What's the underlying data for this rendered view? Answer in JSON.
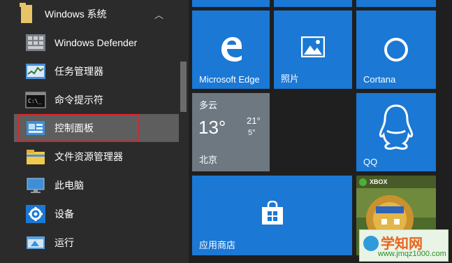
{
  "app_list": {
    "group": {
      "label": "Windows 系统",
      "icon": "folder-icon",
      "expanded": true
    },
    "items": [
      {
        "label": "Windows Defender",
        "icon": "windows-defender-icon"
      },
      {
        "label": "任务管理器",
        "icon": "task-manager-icon"
      },
      {
        "label": "命令提示符",
        "icon": "command-prompt-icon"
      },
      {
        "label": "控制面板",
        "icon": "control-panel-icon",
        "highlighted": true
      },
      {
        "label": "文件资源管理器",
        "icon": "file-explorer-icon"
      },
      {
        "label": "此电脑",
        "icon": "this-pc-icon"
      },
      {
        "label": "设备",
        "icon": "settings-gear-icon"
      },
      {
        "label": "运行",
        "icon": "run-icon"
      }
    ]
  },
  "tiles": {
    "edge": {
      "label": "Microsoft Edge",
      "icon": "edge-icon"
    },
    "photos": {
      "label": "照片",
      "icon": "photos-icon"
    },
    "cortana": {
      "label": "Cortana",
      "icon": "cortana-icon"
    },
    "weather": {
      "condition": "多云",
      "temp": "13°",
      "high": "21°",
      "low": "5°",
      "city": "北京"
    },
    "qq": {
      "label": "QQ",
      "icon": "qq-penguin-icon"
    },
    "store": {
      "label": "应用商店",
      "icon": "store-bag-icon"
    },
    "game": {
      "badge": "XBOX",
      "icon": "game-art"
    }
  },
  "colors": {
    "accent": "#1b78d4",
    "list_bg": "#2b2b2b",
    "highlight_border": "#d9252a",
    "weather_bg": "#6d7881"
  },
  "watermark": {
    "main": "学知网",
    "url": "www.jmqz1000.com"
  }
}
